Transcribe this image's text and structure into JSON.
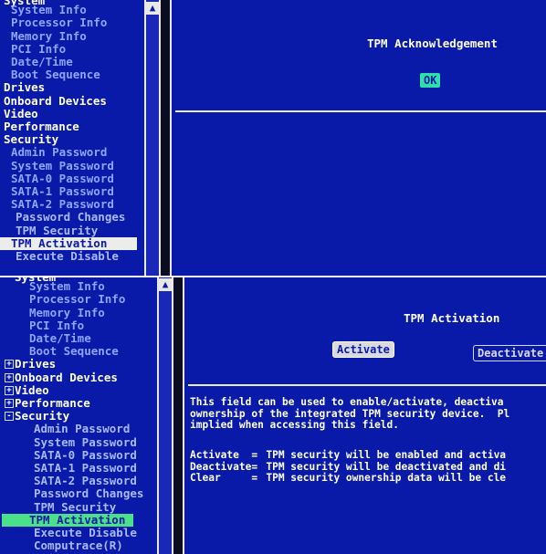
{
  "top_shot": {
    "tree": [
      {
        "label": "System",
        "kind": "cat"
      },
      {
        "label": "System Info",
        "kind": "item"
      },
      {
        "label": "Processor Info",
        "kind": "item"
      },
      {
        "label": "Memory Info",
        "kind": "item"
      },
      {
        "label": "PCI Info",
        "kind": "item"
      },
      {
        "label": "Date/Time",
        "kind": "item"
      },
      {
        "label": "Boot Sequence",
        "kind": "item"
      },
      {
        "label": "Drives",
        "kind": "cat"
      },
      {
        "label": "Onboard Devices",
        "kind": "cat"
      },
      {
        "label": "Video",
        "kind": "cat"
      },
      {
        "label": "Performance",
        "kind": "cat"
      },
      {
        "label": "Security",
        "kind": "cat"
      },
      {
        "label": "Admin Password",
        "kind": "item"
      },
      {
        "label": "System Password",
        "kind": "item"
      },
      {
        "label": "SATA-0 Password",
        "kind": "item"
      },
      {
        "label": "SATA-1 Password",
        "kind": "item"
      },
      {
        "label": "SATA-2 Password",
        "kind": "item"
      },
      {
        "label": "Password Changes",
        "kind": "sub"
      },
      {
        "label": "TPM Security",
        "kind": "sub"
      },
      {
        "label": "TPM Activation",
        "kind": "sel"
      },
      {
        "label": "Execute Disable",
        "kind": "sub"
      }
    ],
    "panel": {
      "title": "TPM Acknowledgement",
      "ok_label": "OK"
    },
    "scroll_up_glyph": "▲"
  },
  "bottom_shot": {
    "tree": [
      {
        "label": "System",
        "kind": "cat"
      },
      {
        "label": "System Info",
        "kind": "item"
      },
      {
        "label": "Processor Info",
        "kind": "item"
      },
      {
        "label": "Memory Info",
        "kind": "item"
      },
      {
        "label": "PCI Info",
        "kind": "item"
      },
      {
        "label": "Date/Time",
        "kind": "item"
      },
      {
        "label": "Boot Sequence",
        "kind": "item"
      },
      {
        "label": "Drives",
        "kind": "cat",
        "expander": "+"
      },
      {
        "label": "Onboard Devices",
        "kind": "cat",
        "expander": "+"
      },
      {
        "label": "Video",
        "kind": "cat",
        "expander": "+"
      },
      {
        "label": "Performance",
        "kind": "cat",
        "expander": "+"
      },
      {
        "label": "Security",
        "kind": "cat",
        "expander": "-"
      },
      {
        "label": "Admin Password",
        "kind": "sub"
      },
      {
        "label": "System Password",
        "kind": "sub"
      },
      {
        "label": "SATA-0 Password",
        "kind": "sub"
      },
      {
        "label": "SATA-1 Password",
        "kind": "sub"
      },
      {
        "label": "SATA-2 Password",
        "kind": "sub"
      },
      {
        "label": "Password Changes",
        "kind": "sub"
      },
      {
        "label": "TPM Security",
        "kind": "sub"
      },
      {
        "label": "TPM Activation",
        "kind": "sel"
      },
      {
        "label": "Execute Disable",
        "kind": "sub"
      },
      {
        "label": "Computrace(R)",
        "kind": "sub"
      }
    ],
    "panel": {
      "title": "TPM Activation",
      "activate_label": "Activate",
      "deactivate_label": "Deactivate",
      "help_lines": [
        "This field can be used to enable/activate, deactiva",
        "ownership of the integrated TPM security device.  Pl",
        "implied when accessing this field."
      ],
      "options": [
        {
          "name": "Activate",
          "eq": "=",
          "desc": "TPM security will be enabled and activa"
        },
        {
          "name": "Deactivate",
          "eq": "=",
          "desc": "TPM security will be deactivated and di"
        },
        {
          "name": "Clear",
          "eq": "=",
          "desc": "TPM security ownership data will be cle"
        }
      ]
    },
    "scroll_up_glyph": "▲"
  },
  "colors": {
    "bios_blue": "#0a1aa8",
    "top_selection": "#ececec",
    "bottom_selection": "#4be08a",
    "ok_button": "#2ee0a8",
    "frame": "#e8e8e8"
  }
}
